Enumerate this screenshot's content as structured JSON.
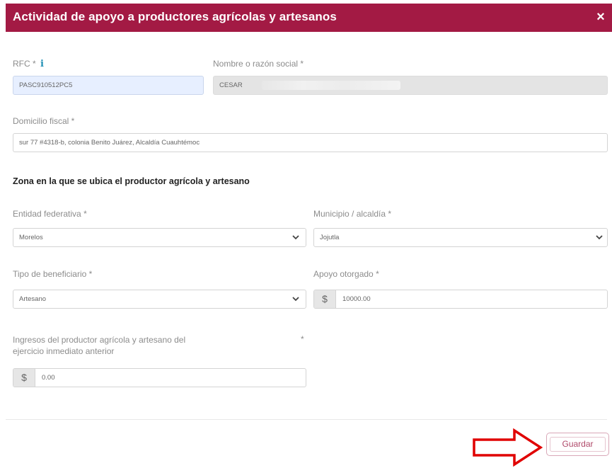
{
  "dialog": {
    "title": "Actividad de apoyo a productores agrícolas y artesanos",
    "close_label": "×"
  },
  "form": {
    "rfc": {
      "label": "RFC *",
      "value": "PASC910512PC5"
    },
    "nombre": {
      "label": "Nombre o razón social *",
      "value": "CESAR"
    },
    "domicilio": {
      "label": "Domicilio fiscal *",
      "value": "sur 77 #4318-b, colonia Benito Juárez, Alcaldía Cuauhtémoc"
    },
    "section_title": "Zona en la que se ubica el productor agrícola y artesano",
    "entidad": {
      "label": "Entidad federativa *",
      "value": "Morelos"
    },
    "municipio": {
      "label": "Municipio / alcaldía *",
      "value": "Jojutla"
    },
    "tipo": {
      "label": "Tipo de beneficiario *",
      "value": "Artesano"
    },
    "apoyo": {
      "label": "Apoyo otorgado *",
      "currency": "$",
      "value": "10000.00"
    },
    "ingresos": {
      "label_line1": "Ingresos del productor agrícola y artesano del",
      "label_line2": "ejercicio inmediato anterior",
      "required": "*",
      "currency": "$",
      "value": "0.00"
    }
  },
  "footer": {
    "save_label": "Guardar"
  },
  "colors": {
    "header_bg": "#a31a44",
    "annotation_arrow": "#e00000"
  }
}
